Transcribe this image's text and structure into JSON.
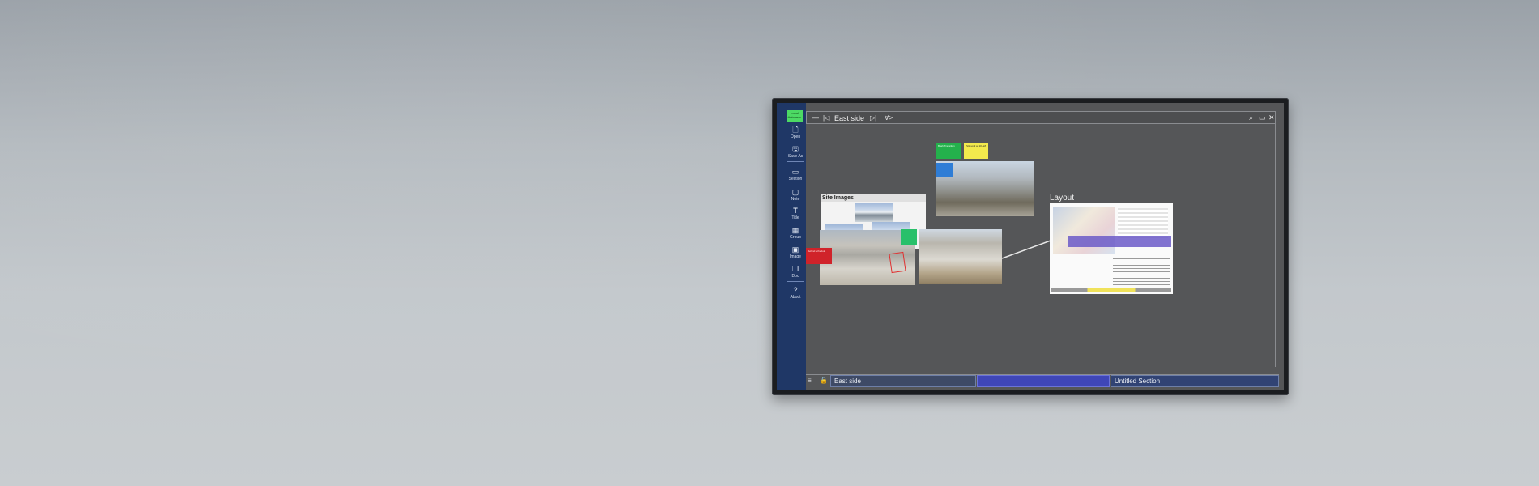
{
  "rail": {
    "badge": "Local Autosave",
    "items": [
      {
        "icon": "open-icon",
        "glyph": "🗋",
        "label": "Open"
      },
      {
        "icon": "save-as-icon",
        "glyph": "🖫",
        "label": "Save As"
      },
      {
        "icon": "section-icon",
        "glyph": "▭",
        "label": "Section"
      },
      {
        "icon": "note-icon",
        "glyph": "▢",
        "label": "Note"
      },
      {
        "icon": "title-icon",
        "glyph": "T",
        "label": "Title"
      },
      {
        "icon": "group-icon",
        "glyph": "▦",
        "label": "Group"
      },
      {
        "icon": "image-icon",
        "glyph": "▣",
        "label": "Image"
      },
      {
        "icon": "doc-icon",
        "glyph": "❐",
        "label": "Doc"
      },
      {
        "icon": "about-icon",
        "glyph": "?",
        "label": "About"
      }
    ]
  },
  "titlebar": {
    "minimize": "—",
    "first": "|◁",
    "title": "East side",
    "next": "▷|",
    "filter": "∀>",
    "search": "⌕",
    "restore": "▭",
    "close": "✕"
  },
  "canvas": {
    "site_images_title": "Site Images",
    "layout_label": "Layout",
    "stickies": {
      "green": "Bash Transition",
      "yellow": "Pick up 2 at 10 AM",
      "red": "Behind schedule"
    }
  },
  "bottombar": {
    "list_icon": "≡",
    "lock_icon": "🔒",
    "tabs": [
      "East side",
      "",
      "Untitled Section"
    ]
  },
  "colors": {
    "rail": "#1f3766",
    "canvas": "#555658",
    "badge": "#4cd964",
    "active_tab": "#3f46b8"
  }
}
